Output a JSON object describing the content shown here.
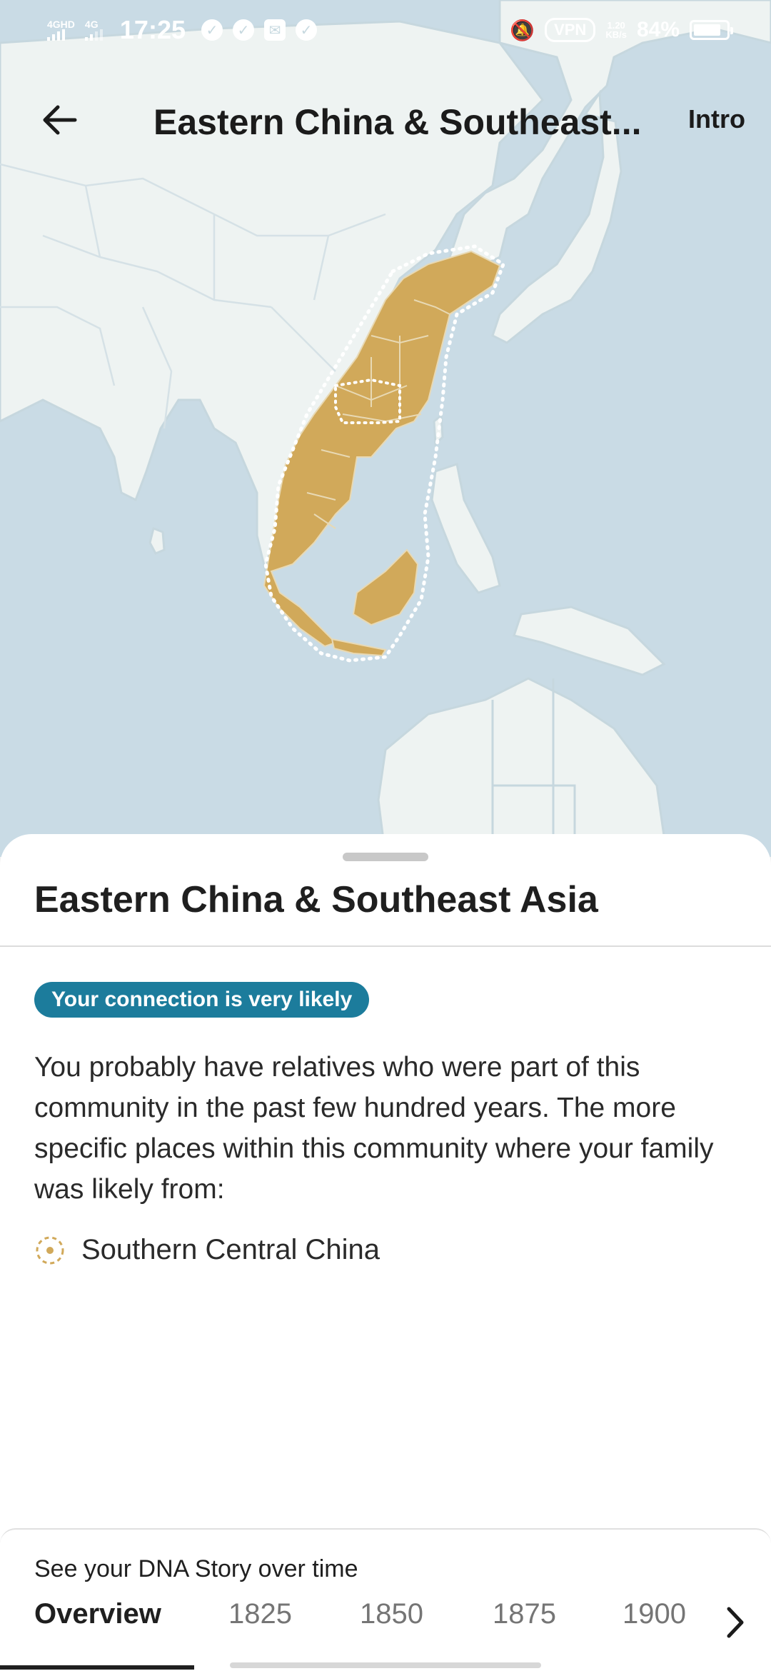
{
  "status_bar": {
    "network_1": "4GHD",
    "network_2": "4G",
    "time": "17:25",
    "vpn": "VPN",
    "speed_value": "1.20",
    "speed_unit": "KB/s",
    "battery": "84%"
  },
  "header": {
    "title": "Eastern China & Southeast...",
    "intro": "Intro"
  },
  "sheet": {
    "title": "Eastern China & Southeast Asia",
    "badge": "Your connection is very likely",
    "description": "You probably have relatives who were part of this community in the past few hundred years. The more specific places within this community where your family was likely from:",
    "places": [
      {
        "label": "Southern Central China"
      }
    ]
  },
  "timeline": {
    "caption": "See your DNA Story over time",
    "tabs": [
      "Overview",
      "1825",
      "1850",
      "1875",
      "1900"
    ],
    "active_tab": "Overview"
  },
  "colors": {
    "region": "#d1a95a",
    "badge": "#1c7c9c",
    "ocean": "#c9dbe5",
    "land": "#eef3f2"
  }
}
